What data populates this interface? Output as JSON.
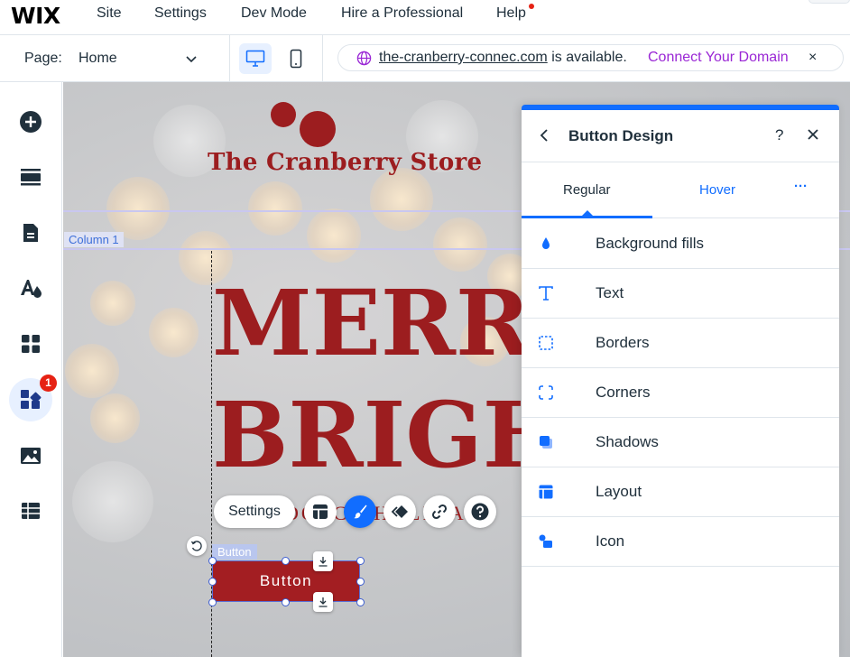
{
  "brand": "WIX",
  "top_menu": [
    "Site",
    "Settings",
    "Dev Mode",
    "Hire a Professional",
    "Help"
  ],
  "colors": {
    "accent": "#116dff",
    "brand_red": "#9c1d1f",
    "connect_purple": "#9a27d5",
    "notification_red": "#e62214"
  },
  "page_selector": {
    "label": "Page:",
    "value": "Home"
  },
  "domain_bar": {
    "domain": "the-cranberry-connec.com",
    "status": "is available.",
    "action": "Connect Your Domain",
    "close": "×"
  },
  "sidebar": {
    "items": [
      "add-icon",
      "sections-icon",
      "pages-icon",
      "design-icon",
      "apps-icon",
      "business-apps-icon",
      "media-icon",
      "cms-icon"
    ],
    "badge": "1"
  },
  "canvas": {
    "store_name": "The Cranberry Store",
    "column_label": "Column 1",
    "headline_1": "MERRY",
    "headline_2": "BRIGH",
    "subtitle": "DOTCH HOLIDAY",
    "toolbar": {
      "settings_label": "Settings"
    },
    "button_tag": "Button",
    "button_label": "Button"
  },
  "panel": {
    "title": "Button Design",
    "help": "?",
    "tabs": {
      "regular": "Regular",
      "hover": "Hover",
      "more": "···"
    },
    "options": [
      {
        "label": "Background fills",
        "icon": "drop-icon"
      },
      {
        "label": "Text",
        "icon": "text-icon"
      },
      {
        "label": "Borders",
        "icon": "borders-icon"
      },
      {
        "label": "Corners",
        "icon": "corners-icon"
      },
      {
        "label": "Shadows",
        "icon": "shadows-icon"
      },
      {
        "label": "Layout",
        "icon": "layout-icon"
      },
      {
        "label": "Icon",
        "icon": "icon-icon"
      }
    ]
  }
}
